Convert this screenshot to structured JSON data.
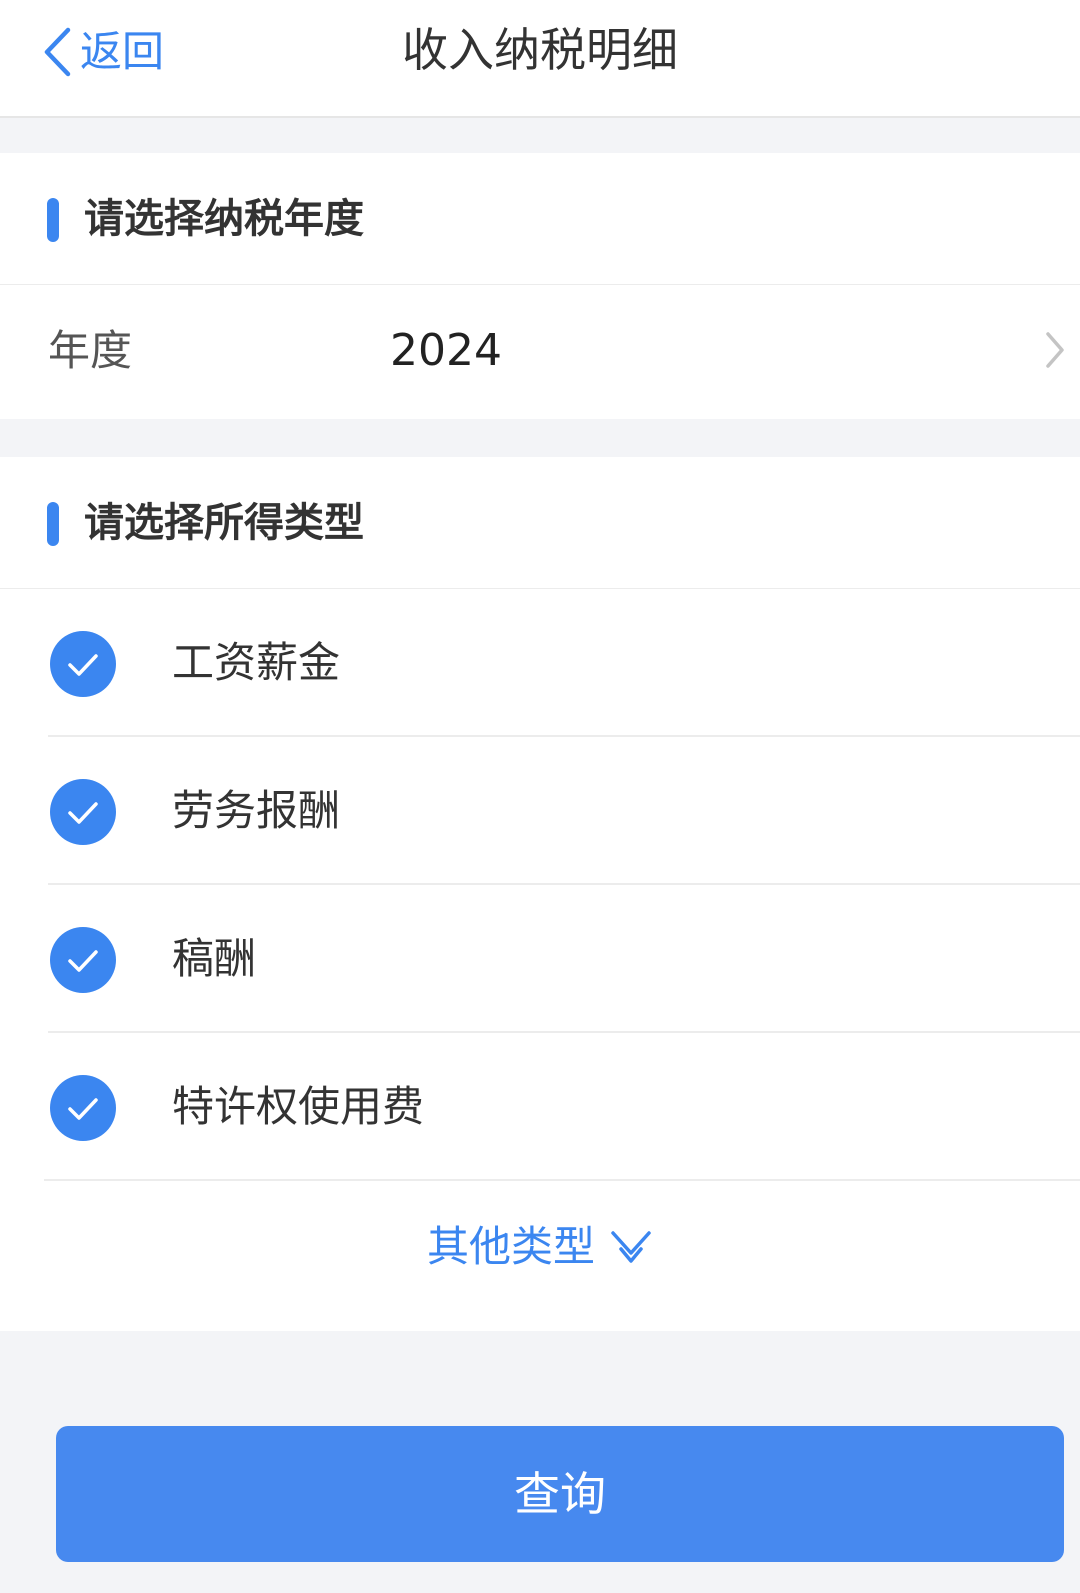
{
  "header": {
    "back_label": "返回",
    "title": "收入纳税明细"
  },
  "year_section": {
    "title": "请选择纳税年度",
    "field_label": "年度",
    "field_value": "2024"
  },
  "type_section": {
    "title": "请选择所得类型",
    "items": [
      {
        "label": "工资薪金",
        "checked": true
      },
      {
        "label": "劳务报酬",
        "checked": true
      },
      {
        "label": "稿酬",
        "checked": true
      },
      {
        "label": "特许权使用费",
        "checked": true
      }
    ],
    "more_label": "其他类型"
  },
  "query_button": {
    "label": "查询"
  },
  "colors": {
    "accent": "#3b86f0",
    "button": "#4789ef",
    "background": "#f3f4f7"
  },
  "icons": {
    "back": "chevron-left-icon",
    "year_arrow": "chevron-right-icon",
    "checkbox": "check-circle-icon",
    "more": "chevron-down-icon"
  }
}
